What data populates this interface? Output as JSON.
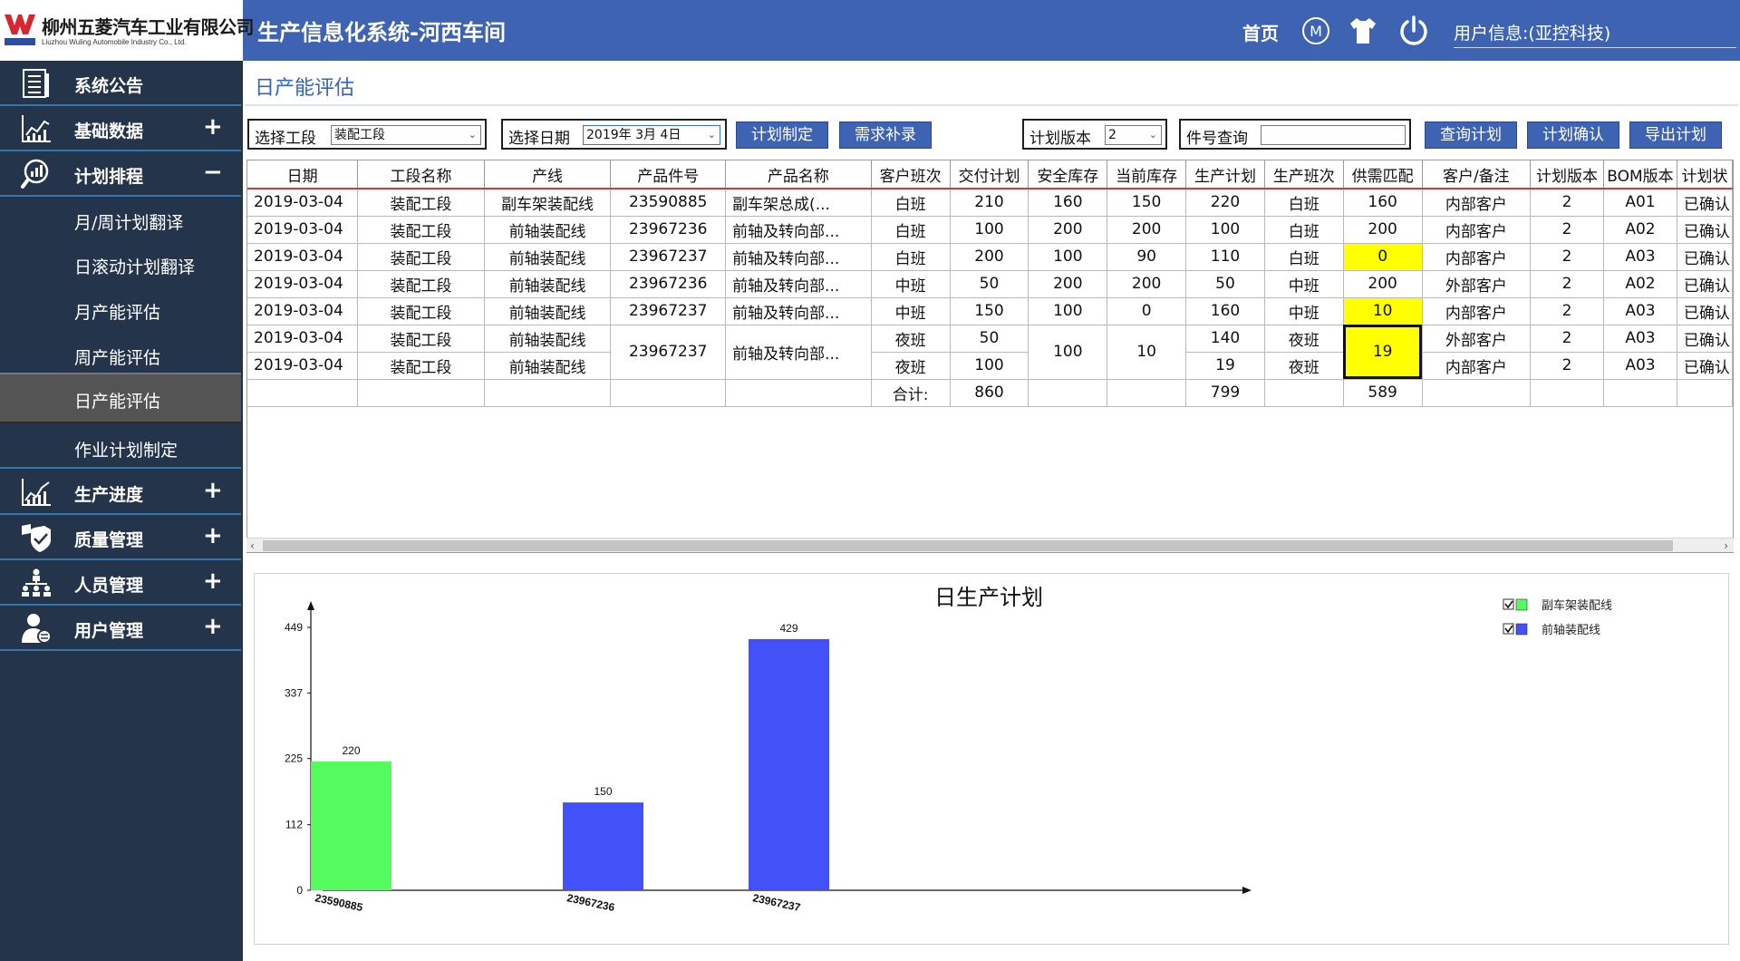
{
  "brand": {
    "name_cn": "柳州五菱汽车工业有限公司",
    "name_en": "Liuzhou Wuling Automobile Industry Co., Ltd.",
    "system_title": "生产信息化系统-河西车间",
    "brand_color": "#3d63b2"
  },
  "header": {
    "home_label": "首页",
    "m_label": "M",
    "user_info": "用户信息:(亚控科技)",
    "icons": [
      "m-circle-icon",
      "shirt-icon",
      "power-icon"
    ]
  },
  "sidebar": {
    "items": [
      {
        "label": "系统公告",
        "icon": "notice-icon",
        "toggle": ""
      },
      {
        "label": "基础数据",
        "icon": "data-chart-icon",
        "toggle": "+"
      },
      {
        "label": "计划排程",
        "icon": "magnifier-chart-icon",
        "toggle": "−"
      }
    ],
    "sub_items": [
      {
        "label": "月/周计划翻译"
      },
      {
        "label": "日滚动计划翻译"
      },
      {
        "label": "月产能评估"
      },
      {
        "label": "周产能评估"
      },
      {
        "label": "日产能评估",
        "active": true
      },
      {
        "label": "作业计划制定"
      }
    ],
    "items_after": [
      {
        "label": "生产进度",
        "icon": "progress-chart-icon",
        "toggle": "+"
      },
      {
        "label": "质量管理",
        "icon": "shield-icon",
        "toggle": "+"
      },
      {
        "label": "人员管理",
        "icon": "org-chart-icon",
        "toggle": "+"
      },
      {
        "label": "用户管理",
        "icon": "user-icon",
        "toggle": "+"
      }
    ]
  },
  "page": {
    "title": "日产能评估"
  },
  "filters": {
    "section_label": "选择工段",
    "section_value": "装配工段",
    "date_label": "选择日期",
    "date_value": "2019年  3月  4日",
    "version_label": "计划版本",
    "version_value": "2",
    "part_label": "件号查询",
    "part_value": ""
  },
  "buttons": {
    "plan_make": "计划制定",
    "demand_fill": "需求补录",
    "query_plan": "查询计划",
    "confirm_plan": "计划确认",
    "export_plan": "导出计划"
  },
  "table": {
    "headers": [
      "日期",
      "工段名称",
      "产线",
      "产品件号",
      "产品名称",
      "客户班次",
      "交付计划",
      "安全库存",
      "当前库存",
      "生产计划",
      "生产班次",
      "供需匹配",
      "客户/备注",
      "计划版本",
      "BOM版本",
      "计划状"
    ],
    "rows": [
      [
        "2019-03-04",
        "装配工段",
        "副车架装配线",
        "23590885",
        "副车架总成(...",
        "白班",
        "210",
        "160",
        "150",
        "220",
        "白班",
        "160",
        "内部客户",
        "2",
        "A01",
        "已确认"
      ],
      [
        "2019-03-04",
        "装配工段",
        "前轴装配线",
        "23967236",
        "前轴及转向部...",
        "白班",
        "100",
        "200",
        "200",
        "100",
        "白班",
        "200",
        "内部客户",
        "2",
        "A02",
        "已确认"
      ],
      [
        "2019-03-04",
        "装配工段",
        "前轴装配线",
        "23967237",
        "前轴及转向部...",
        "白班",
        "200",
        "100",
        "90",
        "110",
        "白班",
        "0",
        "内部客户",
        "2",
        "A03",
        "已确认"
      ],
      [
        "2019-03-04",
        "装配工段",
        "前轴装配线",
        "23967236",
        "前轴及转向部...",
        "中班",
        "50",
        "200",
        "200",
        "50",
        "中班",
        "200",
        "外部客户",
        "2",
        "A02",
        "已确认"
      ],
      [
        "2019-03-04",
        "装配工段",
        "前轴装配线",
        "23967237",
        "前轴及转向部...",
        "中班",
        "150",
        "100",
        "0",
        "160",
        "中班",
        "10",
        "内部客户",
        "2",
        "A03",
        "已确认"
      ]
    ],
    "merged_rows": {
      "date": [
        "2019-03-04",
        "2019-03-04"
      ],
      "section": [
        "装配工段",
        "装配工段"
      ],
      "line": [
        "前轴装配线",
        "前轴装配线"
      ],
      "part_no": "23967237",
      "product": "前轴及转向部...",
      "cust_shift": [
        "夜班",
        "夜班"
      ],
      "delivery": [
        "50",
        "100"
      ],
      "safety_stock": "100",
      "current_stock": "10",
      "prod_plan": [
        "140",
        "19"
      ],
      "prod_shift": [
        "夜班",
        "夜班"
      ],
      "match": "19",
      "remark": [
        "外部客户",
        "内部客户"
      ],
      "version": [
        "2",
        "2"
      ],
      "bom": [
        "A03",
        "A03"
      ],
      "status": [
        "已确认",
        "已确认"
      ]
    },
    "total": {
      "label": "合计:",
      "delivery": "860",
      "prod_plan": "799",
      "match": "589"
    },
    "highlight_color": "#ffff00"
  },
  "chart_data": {
    "type": "bar",
    "title": "日生产计划",
    "categories": [
      "23590885",
      "23967236",
      "23967237"
    ],
    "series": [
      {
        "name": "副车架装配线",
        "color": "#55fb5e",
        "values": [
          220,
          null,
          null
        ]
      },
      {
        "name": "前轴装配线",
        "color": "#4351f8",
        "values": [
          null,
          150,
          429
        ]
      }
    ],
    "yticks": [
      0,
      112,
      225,
      337,
      449
    ],
    "ylim": [
      0,
      449
    ],
    "legend_position": "top-right",
    "grid": false
  }
}
